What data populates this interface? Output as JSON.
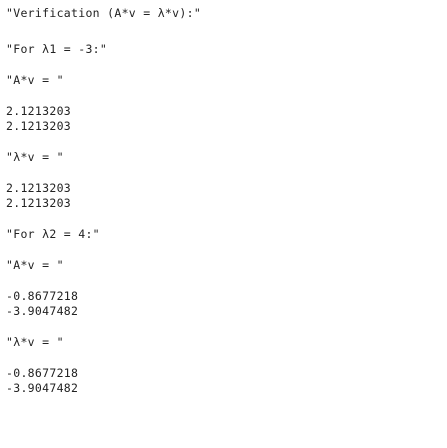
{
  "output": {
    "header": "\"Verification (A*v = λ*v):\"",
    "eigen1": {
      "label": "\"For λ1 = -3:\"",
      "av_label": "\"A*v = \"",
      "av_values": [
        "2.1213203",
        "2.1213203"
      ],
      "lv_label": "\"λ*v = \"",
      "lv_values": [
        "2.1213203",
        "2.1213203"
      ]
    },
    "eigen2": {
      "label": "\"For λ2 = 4:\"",
      "av_label": "\"A*v = \"",
      "av_values": [
        "-0.8677218",
        "-3.9047482"
      ],
      "lv_label": "\"λ*v = \"",
      "lv_values": [
        "-0.8677218",
        "-3.9047482"
      ]
    }
  }
}
